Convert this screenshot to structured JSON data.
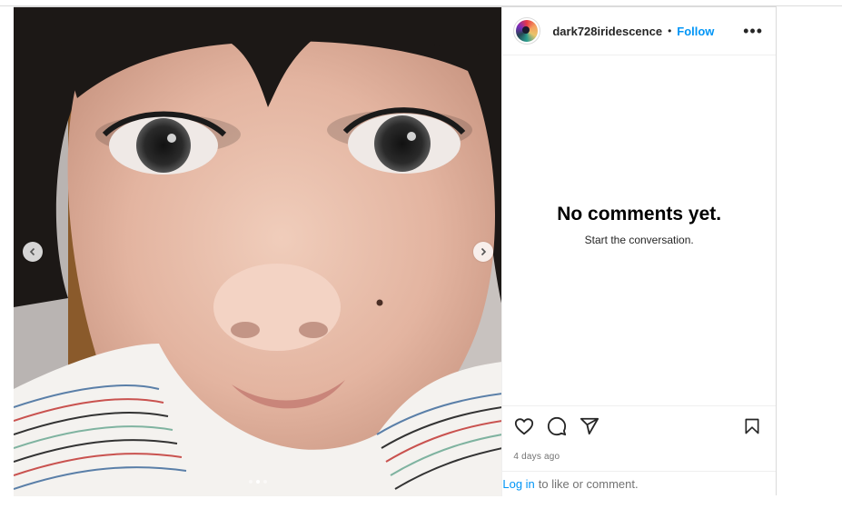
{
  "header": {
    "username": "dark728iridescence",
    "separator": "•",
    "follow_label": "Follow",
    "more_label": "•••"
  },
  "media": {
    "slide_count": 3,
    "active_slide": 2,
    "prev_icon": "chevron-left-icon",
    "next_icon": "chevron-right-icon"
  },
  "comments": {
    "empty_title": "No comments yet.",
    "empty_subtitle": "Start the conversation."
  },
  "actions": {
    "like_icon": "heart-icon",
    "comment_icon": "comment-icon",
    "share_icon": "paper-plane-icon",
    "save_icon": "bookmark-icon",
    "timestamp": "4 days ago"
  },
  "footer": {
    "login_link": "Log in",
    "login_text": "to like or comment."
  },
  "colors": {
    "link_blue": "#0095f6",
    "muted_text": "#737373",
    "border": "#dbdbdb"
  }
}
